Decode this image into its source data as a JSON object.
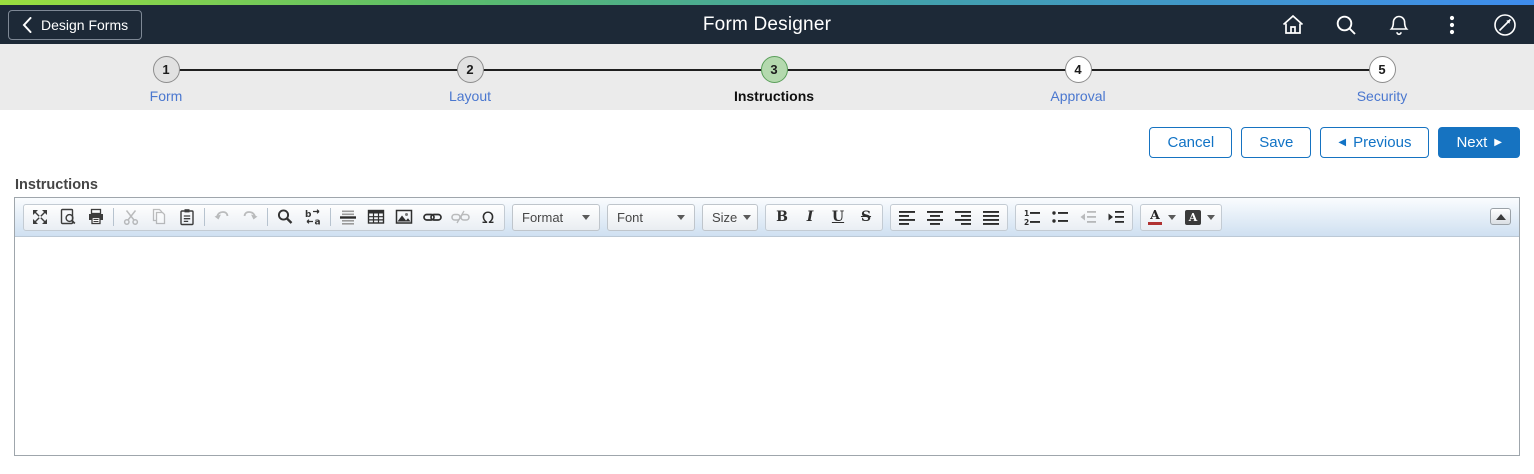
{
  "header": {
    "back_label": "Design Forms",
    "title": "Form Designer",
    "icons": [
      "home",
      "search",
      "notifications",
      "more-options",
      "navbar"
    ]
  },
  "stepper": {
    "steps": [
      {
        "number": "1",
        "label": "Form",
        "state": "visited"
      },
      {
        "number": "2",
        "label": "Layout",
        "state": "visited"
      },
      {
        "number": "3",
        "label": "Instructions",
        "state": "active"
      },
      {
        "number": "4",
        "label": "Approval",
        "state": "upcoming"
      },
      {
        "number": "5",
        "label": "Security",
        "state": "upcoming"
      }
    ]
  },
  "actions": {
    "cancel_label": "Cancel",
    "save_label": "Save",
    "previous_label": "Previous",
    "next_label": "Next"
  },
  "section": {
    "label": "Instructions"
  },
  "editor": {
    "content": "",
    "toolbar": {
      "icon_groups": [
        [
          "maximize",
          "preview",
          "print",
          "cut",
          "copy",
          "paste",
          "undo",
          "redo",
          "find",
          "replace",
          "horizontal-line",
          "table",
          "image",
          "link",
          "unlink",
          "special-character"
        ],
        [
          "bold",
          "italic",
          "underline",
          "strikethrough"
        ],
        [
          "align-left",
          "align-center",
          "align-right",
          "align-justify"
        ],
        [
          "numbered-list",
          "bulleted-list",
          "decrease-indent",
          "increase-indent"
        ],
        [
          "text-color",
          "background-color"
        ],
        [
          "collapse-toolbar"
        ]
      ],
      "disabled_tools": [
        "cut",
        "copy",
        "undo",
        "redo",
        "unlink",
        "decrease-indent"
      ],
      "dropdowns": [
        {
          "name": "format",
          "label": "Format"
        },
        {
          "name": "font",
          "label": "Font"
        },
        {
          "name": "size",
          "label": "Size"
        }
      ],
      "glyphs": {
        "bold": "B",
        "italic": "I",
        "underline": "U",
        "strike": "S",
        "omega": "Ω",
        "text_color": "A",
        "bg_color": "A"
      }
    }
  },
  "colors": {
    "header_bg": "#1d2937",
    "top_gradient_start": "#9ade3f",
    "top_gradient_end": "#3e8ced",
    "accent_blue": "#1673c1",
    "link_blue": "#4a77cf",
    "step_active_fill": "#b4d9ae",
    "step_active_border": "#5a9f5a",
    "stepper_band_bg": "#ebebeb",
    "toolbar_gradient_bottom": "#cfe0f1"
  }
}
